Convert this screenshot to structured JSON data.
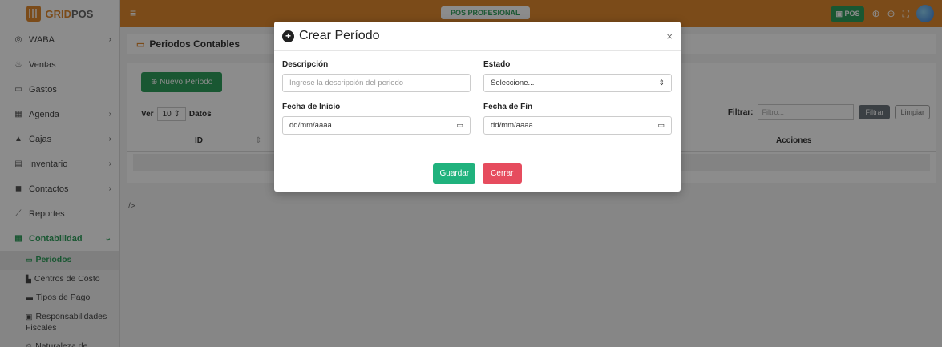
{
  "brand": {
    "name_a": "GRID",
    "name_b": "POS"
  },
  "sidebar": {
    "items": [
      {
        "icon": "whatsapp-icon",
        "glyph": "◎",
        "label": "WABA",
        "chev": "›"
      },
      {
        "icon": "hand-coins-icon",
        "glyph": "♨",
        "label": "Ventas",
        "chev": ""
      },
      {
        "icon": "money-icon",
        "glyph": "▭",
        "label": "Gastos",
        "chev": ""
      },
      {
        "icon": "calendar-icon",
        "glyph": "▦",
        "label": "Agenda",
        "chev": "›"
      },
      {
        "icon": "cash-register-icon",
        "glyph": "▲",
        "label": "Cajas",
        "chev": "›"
      },
      {
        "icon": "inventory-icon",
        "glyph": "▤",
        "label": "Inventario",
        "chev": "›"
      },
      {
        "icon": "contacts-icon",
        "glyph": "◼",
        "label": "Contactos",
        "chev": "›"
      },
      {
        "icon": "chart-line-icon",
        "glyph": "⟋",
        "label": "Reportes",
        "chev": ""
      },
      {
        "icon": "table-icon",
        "glyph": "▦",
        "label": "Contabilidad",
        "chev": "⌄"
      }
    ],
    "sub_items": [
      {
        "glyph": "▭",
        "label": "Periodos"
      },
      {
        "glyph": "▙",
        "label": "Centros de Costo"
      },
      {
        "glyph": "▬",
        "label": "Tipos de Pago"
      },
      {
        "glyph": "▣",
        "label": "Responsabilidades Fiscales"
      },
      {
        "glyph": "⚖",
        "label": "Naturaleza de"
      }
    ]
  },
  "topbar": {
    "hamburger": "≡",
    "center_badge": "POS PROFESIONAL",
    "pos_button": "POS"
  },
  "page": {
    "breadcrumb": "Periodos Contables",
    "new_button": "Nuevo Periodo",
    "ver_label": "Ver",
    "ver_value": "10",
    "datos_label": "Datos",
    "filter_label": "Filtrar:",
    "filter_placeholder": "Filtro...",
    "filter_button": "Filtrar",
    "clear_button": "Limpiar",
    "col_id": "ID",
    "col_acciones": "Acciones",
    "footer_text": "/>"
  },
  "modal": {
    "title": "Crear Período",
    "close": "×",
    "descripcion_label": "Descripción",
    "descripcion_placeholder": "Ingrese la descripción del periodo",
    "estado_label": "Estado",
    "estado_value": "Seleccione...",
    "fecha_inicio_label": "Fecha de Inicio",
    "fecha_inicio_value": "dd/mm/aaaa",
    "fecha_fin_label": "Fecha de Fin",
    "fecha_fin_value": "dd/mm/aaaa",
    "save_button": "Guardar",
    "close_button": "Cerrar"
  },
  "colors": {
    "brand_orange": "#e0892f",
    "accent_green": "#2f9e5b",
    "save_green": "#20b27d",
    "close_red": "#e64c5e"
  }
}
